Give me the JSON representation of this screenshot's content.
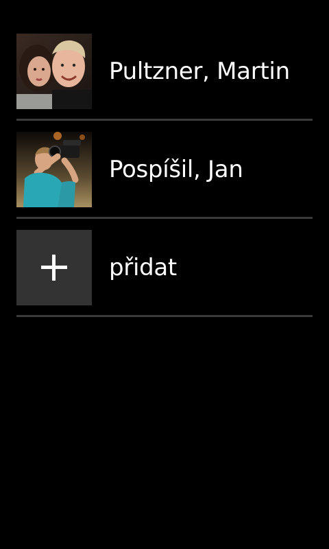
{
  "contacts": [
    {
      "name": "Pultzner, Martin",
      "photo_icon": "couple-selfie-photo"
    },
    {
      "name": "Pospíšil, Jan",
      "photo_icon": "person-with-camera-photo"
    }
  ],
  "add_item": {
    "label": "přidat",
    "icon": "plus-icon"
  },
  "colors": {
    "background": "#000000",
    "divider": "#3a3a3a",
    "add_tile": "#333333",
    "text": "#ffffff"
  }
}
